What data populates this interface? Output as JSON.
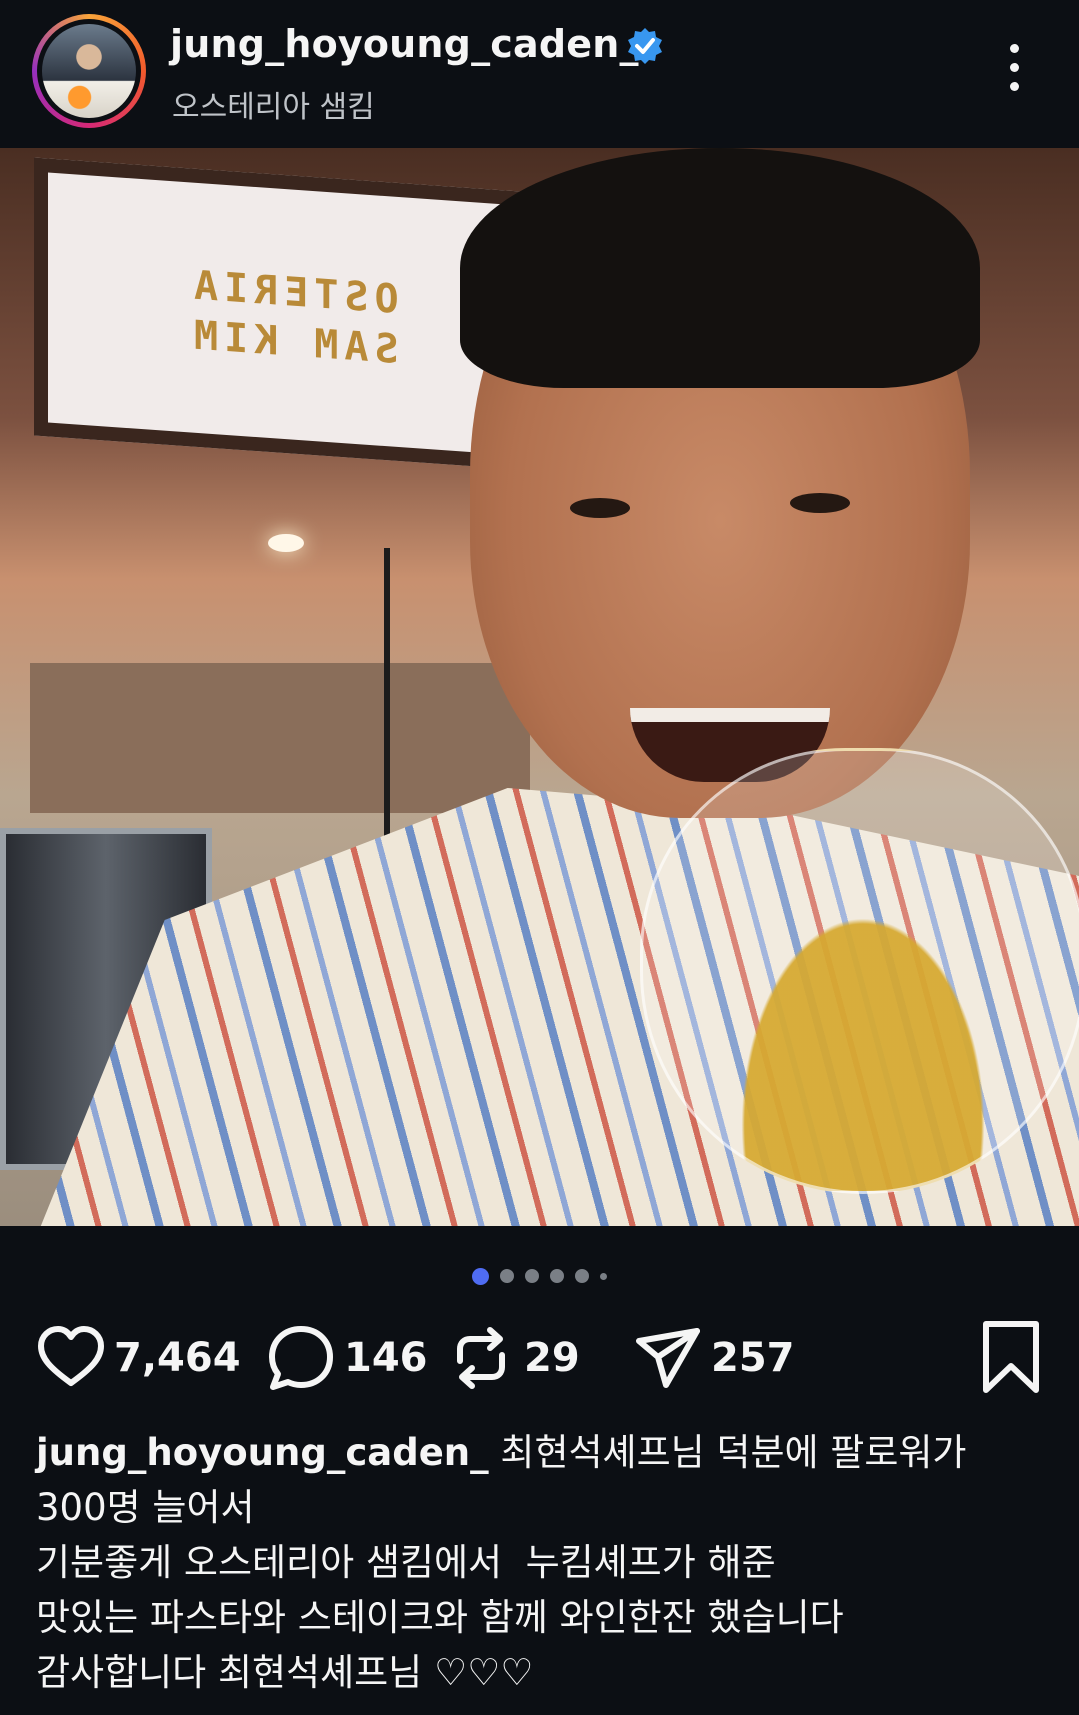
{
  "header": {
    "username": "jung_hoyoung_caden_",
    "location": "오스테리아 샘킴",
    "verified": true,
    "verified_color": "#3897f0"
  },
  "post": {
    "image_sign_text": [
      "OSTERIA",
      "SAM KIM"
    ],
    "carousel": {
      "count": 6,
      "active_index": 0
    }
  },
  "actions": {
    "likes": "7,464",
    "comments": "146",
    "reposts": "29",
    "shares": "257"
  },
  "caption": {
    "user": "jung_hoyoung_caden_",
    "line1": "최현석셰프님 덕분에 팔로워가",
    "line2": "300명 늘어서",
    "line3": "기분좋게 오스테리아 샘킴에서  누킴셰프가 해준",
    "line4": "맛있는 파스타와 스테이크와 함께 와인한잔 했습니다",
    "line5": "감사합니다 최현석셰프님 ♡♡♡"
  },
  "colors": {
    "background": "#0c0f14",
    "accent_dot": "#4f6cf2"
  }
}
